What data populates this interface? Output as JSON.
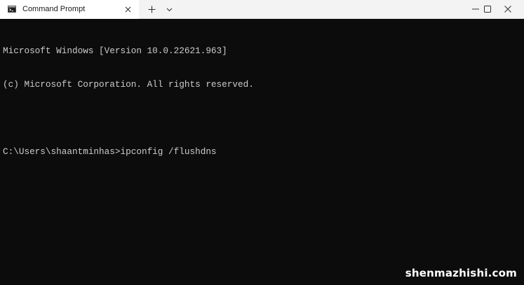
{
  "tab": {
    "title": "Command Prompt",
    "icon": "terminal-icon"
  },
  "titlebar": {
    "new_tab_icon": "plus-icon",
    "dropdown_icon": "chevron-down-icon",
    "minimize_icon": "minimize-icon",
    "maximize_icon": "maximize-icon",
    "close_icon": "close-icon"
  },
  "console": {
    "lines": [
      "Microsoft Windows [Version 10.0.22621.963]",
      "(c) Microsoft Corporation. All rights reserved.",
      "",
      "C:\\Users\\shaantminhas>ipconfig /flushdns"
    ],
    "text_color": "#cccccc",
    "background_color": "#0c0c0c"
  },
  "watermark": "shenmazhishi.com"
}
